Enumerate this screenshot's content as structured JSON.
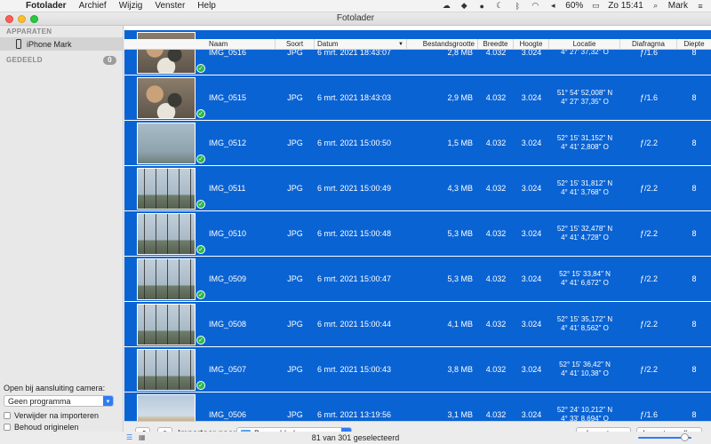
{
  "menubar": {
    "app": "Fotolader",
    "items": [
      "Archief",
      "Wijzig",
      "Venster",
      "Help"
    ],
    "battery": "60%",
    "clock": "Zo 15:41",
    "user": "Mark"
  },
  "window": {
    "title": "Fotolader"
  },
  "sidebar": {
    "devices_header": "APPARATEN",
    "device": "iPhone Mark",
    "shared_header": "GEDEELD",
    "shared_count": "0",
    "open_label": "Open bij aansluiting camera:",
    "open_value": "Geen programma",
    "delete_after": "Verwijder na importeren",
    "keep_originals": "Behoud originelen"
  },
  "table": {
    "columns": {
      "name": "Naam",
      "kind": "Soort",
      "date": "Datum",
      "size": "Bestandsgrootte",
      "width": "Breedte",
      "height": "Hoogte",
      "location": "Locatie",
      "aperture": "Diafragma",
      "depth": "Diepte"
    },
    "rows": [
      {
        "name": "IMG_0516",
        "kind": "JPG",
        "date": "6 mrt. 2021 18:43:07",
        "size": "2,8 MB",
        "width": "4.032",
        "height": "3.024",
        "lat": "",
        "lon": "4° 27' 37,32\" O",
        "aperture": "ƒ/1.6",
        "depth": "8",
        "thumb": "food"
      },
      {
        "name": "IMG_0515",
        "kind": "JPG",
        "date": "6 mrt. 2021 18:43:03",
        "size": "2,9 MB",
        "width": "4.032",
        "height": "3.024",
        "lat": "51° 54' 52,008\" N",
        "lon": "4° 27' 37,35\" O",
        "aperture": "ƒ/1.6",
        "depth": "8",
        "thumb": "food"
      },
      {
        "name": "IMG_0512",
        "kind": "JPG",
        "date": "6 mrt. 2021 15:00:50",
        "size": "1,5 MB",
        "width": "4.032",
        "height": "3.024",
        "lat": "52° 15' 31,152\" N",
        "lon": "4° 41' 2,808\" O",
        "aperture": "ƒ/2.2",
        "depth": "8",
        "thumb": "sky"
      },
      {
        "name": "IMG_0511",
        "kind": "JPG",
        "date": "6 mrt. 2021 15:00:49",
        "size": "4,3 MB",
        "width": "4.032",
        "height": "3.024",
        "lat": "52° 15' 31,812\" N",
        "lon": "4° 41' 3,768\" O",
        "aperture": "ƒ/2.2",
        "depth": "8",
        "thumb": "trees"
      },
      {
        "name": "IMG_0510",
        "kind": "JPG",
        "date": "6 mrt. 2021 15:00:48",
        "size": "5,3 MB",
        "width": "4.032",
        "height": "3.024",
        "lat": "52° 15' 32,478\" N",
        "lon": "4° 41' 4,728\" O",
        "aperture": "ƒ/2.2",
        "depth": "8",
        "thumb": "trees"
      },
      {
        "name": "IMG_0509",
        "kind": "JPG",
        "date": "6 mrt. 2021 15:00:47",
        "size": "5,3 MB",
        "width": "4.032",
        "height": "3.024",
        "lat": "52° 15' 33,84\" N",
        "lon": "4° 41' 6,672\" O",
        "aperture": "ƒ/2.2",
        "depth": "8",
        "thumb": "trees"
      },
      {
        "name": "IMG_0508",
        "kind": "JPG",
        "date": "6 mrt. 2021 15:00:44",
        "size": "4,1 MB",
        "width": "4.032",
        "height": "3.024",
        "lat": "52° 15' 35,172\" N",
        "lon": "4° 41' 8,562\" O",
        "aperture": "ƒ/2.2",
        "depth": "8",
        "thumb": "trees"
      },
      {
        "name": "IMG_0507",
        "kind": "JPG",
        "date": "6 mrt. 2021 15:00:43",
        "size": "3,8 MB",
        "width": "4.032",
        "height": "3.024",
        "lat": "52° 15' 36,42\" N",
        "lon": "4° 41' 10,38\" O",
        "aperture": "ƒ/2.2",
        "depth": "8",
        "thumb": "trees"
      },
      {
        "name": "IMG_0506",
        "kind": "JPG",
        "date": "6 mrt. 2021 13:19:56",
        "size": "3,1 MB",
        "width": "4.032",
        "height": "3.024",
        "lat": "52° 24' 10,212\" N",
        "lon": "4° 33' 8,694\" O",
        "aperture": "ƒ/1.6",
        "depth": "8",
        "thumb": "beach"
      }
    ]
  },
  "bottom": {
    "import_to": "Importeer naar:",
    "destination": "Bureaublad",
    "import": "Importeer",
    "import_all": "Importeer alles"
  },
  "status": {
    "selection": "81 van 301 geselecteerd"
  }
}
